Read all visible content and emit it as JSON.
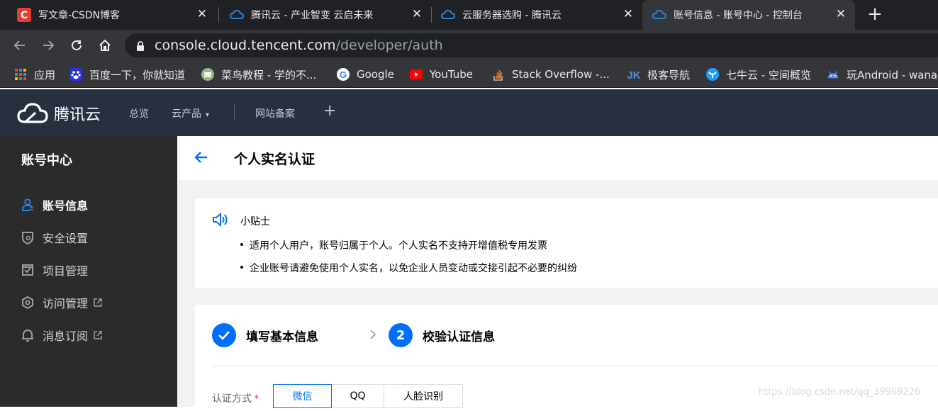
{
  "browser": {
    "tabs": [
      {
        "title": "写文章-CSDN博客",
        "icon": "csdn-icon",
        "active": false
      },
      {
        "title": "腾讯云 - 产业智变 云启未来",
        "icon": "tencent-cloud-icon",
        "active": false
      },
      {
        "title": "云服务器选购 - 腾讯云",
        "icon": "tencent-cloud-icon",
        "active": false
      },
      {
        "title": "账号信息 - 账号中心 - 控制台",
        "icon": "tencent-cloud-icon",
        "active": true
      }
    ],
    "new_tab": "+",
    "address": {
      "host": "console.cloud.tencent.com",
      "path": "/developer/auth"
    },
    "bookmarks": [
      {
        "label": "应用",
        "icon": "apps-grid-icon"
      },
      {
        "label": "百度一下，你就知道",
        "icon": "baidu-paw-icon"
      },
      {
        "label": "菜鸟教程 - 学的不...",
        "icon": "runoob-icon"
      },
      {
        "label": "Google",
        "icon": "google-icon"
      },
      {
        "label": "YouTube",
        "icon": "youtube-icon"
      },
      {
        "label": "Stack Overflow -...",
        "icon": "stackoverflow-icon"
      },
      {
        "label": "极客导航",
        "icon": "jike-icon"
      },
      {
        "label": "七牛云 - 空间概览",
        "icon": "qiniu-icon"
      },
      {
        "label": "玩Android - wana",
        "icon": "android-icon"
      }
    ]
  },
  "console": {
    "brand": "腾讯云",
    "nav": {
      "overview": "总览",
      "products": "云产品",
      "beian": "网站备案",
      "add": "+"
    }
  },
  "sidebar": {
    "title": "账号中心",
    "items": [
      {
        "label": "账号信息",
        "icon": "user-icon",
        "active": true,
        "external": false
      },
      {
        "label": "安全设置",
        "icon": "shield-icon",
        "active": false,
        "external": false
      },
      {
        "label": "项目管理",
        "icon": "project-icon",
        "active": false,
        "external": false
      },
      {
        "label": "访问管理",
        "icon": "access-icon",
        "active": false,
        "external": true
      },
      {
        "label": "消息订阅",
        "icon": "bell-icon",
        "active": false,
        "external": true
      }
    ]
  },
  "page": {
    "title": "个人实名认证",
    "tips": {
      "title": "小贴士",
      "items": [
        "适用个人用户，账号归属于个人。个人实名不支持开增值税专用发票",
        "企业账号请避免使用个人实名，以免企业人员变动或交接引起不必要的纠纷"
      ]
    },
    "steps": [
      {
        "label": "填写基本信息",
        "status": "done"
      },
      {
        "label": "校验认证信息",
        "number": "2",
        "status": "current"
      }
    ],
    "method_label": "认证方式",
    "required_mark": "*",
    "methods": [
      {
        "label": "微信",
        "selected": true
      },
      {
        "label": "QQ",
        "selected": false
      },
      {
        "label": "人脸识别",
        "selected": false
      }
    ]
  },
  "watermark": "https://blog.csdn.net/qq_39969226",
  "colors": {
    "accent": "#006eff",
    "console_header": "#283040",
    "sidebar": "#2b2b2b"
  }
}
